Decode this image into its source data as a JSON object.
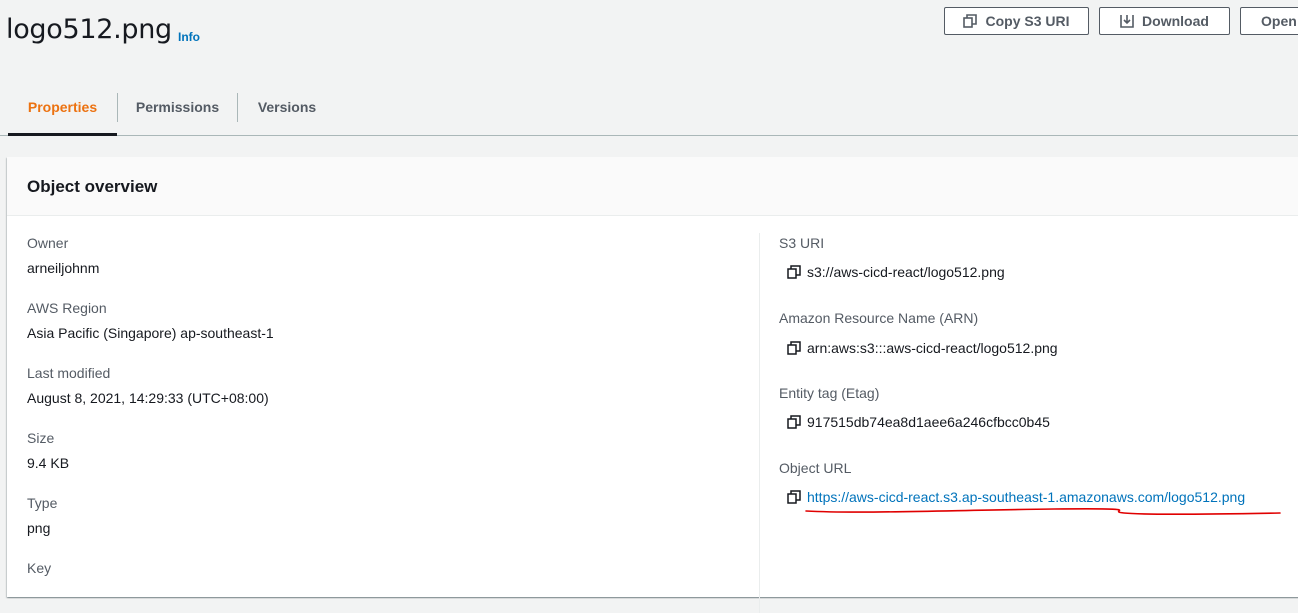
{
  "header": {
    "title": "logo512.png",
    "info_label": "Info",
    "buttons": {
      "copy_s3_uri": "Copy S3 URI",
      "download": "Download",
      "open": "Open"
    }
  },
  "tabs": [
    {
      "label": "Properties",
      "active": true
    },
    {
      "label": "Permissions",
      "active": false
    },
    {
      "label": "Versions",
      "active": false
    }
  ],
  "overview": {
    "title": "Object overview",
    "left": {
      "owner_label": "Owner",
      "owner_value": "arneiljohnm",
      "region_label": "AWS Region",
      "region_value": "Asia Pacific (Singapore) ap-southeast-1",
      "modified_label": "Last modified",
      "modified_value": "August 8, 2021, 14:29:33 (UTC+08:00)",
      "size_label": "Size",
      "size_value": "9.4 KB",
      "type_label": "Type",
      "type_value": "png",
      "key_label": "Key"
    },
    "right": {
      "s3uri_label": "S3 URI",
      "s3uri_value": "s3://aws-cicd-react/logo512.png",
      "arn_label": "Amazon Resource Name (ARN)",
      "arn_value": "arn:aws:s3:::aws-cicd-react/logo512.png",
      "etag_label": "Entity tag (Etag)",
      "etag_value": "917515db74ea8d1aee6a246cfbcc0b45",
      "url_label": "Object URL",
      "url_value": "https://aws-cicd-react.s3.ap-southeast-1.amazonaws.com/logo512.png"
    }
  },
  "colors": {
    "accent": "#ec7211",
    "link": "#0073bb",
    "annotation": "#e00000"
  }
}
